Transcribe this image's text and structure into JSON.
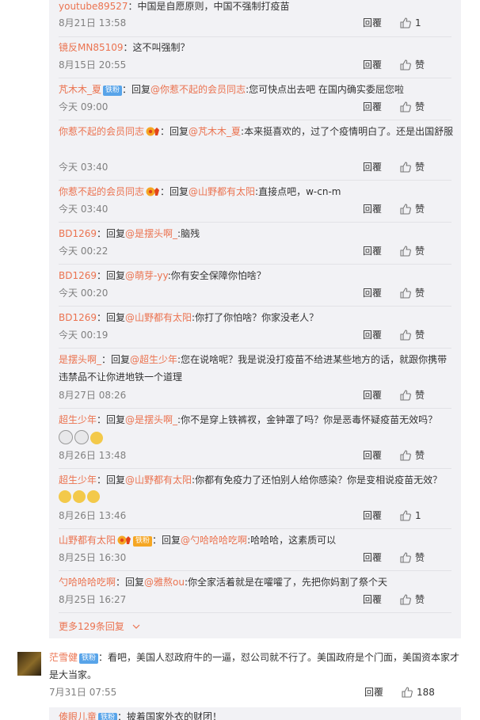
{
  "reply_thread": {
    "replies": [
      {
        "user": "youtube89527",
        "text": "：中国是自愿原则，中国不强制打疫苗",
        "time": "8月21日 13:58",
        "likes": "1"
      },
      {
        "user": "镜反MN85109",
        "text": "：这不叫强制？",
        "time": "8月15日 20:55",
        "likes": "赞"
      },
      {
        "user": "芃木木_夏",
        "badge": "铁粉",
        "reply_prefix": "：回复",
        "reply_to": "@你惹不起的会员同志",
        "text": ":您可快点出去吧 在国内确实委屈您啦",
        "time": "今天 09:00",
        "likes": "赞"
      },
      {
        "user": "你惹不起的会员同志",
        "reply_prefix": "：回复",
        "reply_to": "@芃木木_夏",
        "text": ":本来挺喜欢的，过了个疫情明白了。还是出国舒服",
        "time": "今天 03:40",
        "likes": "赞"
      },
      {
        "user": "你惹不起的会员同志",
        "reply_prefix": "：回复",
        "reply_to": "@山野都有太阳",
        "text": ":直接点吧，w-cn-m",
        "time": "今天 03:40",
        "likes": "赞"
      },
      {
        "user": "BD1269",
        "reply_prefix": "：回复",
        "reply_to": "@是摆头啊_",
        "text": ":脑残",
        "time": "今天 00:22",
        "likes": "赞"
      },
      {
        "user": "BD1269",
        "reply_prefix": "：回复",
        "reply_to": "@萌芽-yy",
        "text": ":你有安全保障你怕啥？",
        "time": "今天 00:20",
        "likes": "赞"
      },
      {
        "user": "BD1269",
        "reply_prefix": "：回复",
        "reply_to": "@山野都有太阳",
        "text": ":你打了你怕啥？你家没老人？",
        "time": "今天 00:19",
        "likes": "赞"
      },
      {
        "user": "是摆头啊_",
        "reply_prefix": "：回复",
        "reply_to": "@超生少年",
        "text": ":您在说啥呢？我是说没打疫苗不给进某些地方的话，就跟你携带违禁品不让你进地铁一个道理",
        "time": "8月27日 08:26",
        "likes": "赞"
      },
      {
        "user": "超生少年",
        "reply_prefix": "：回复",
        "reply_to": "@是摆头啊_",
        "text": ":你不是穿上铁裤衩，金钟罩了吗？你是恶毒怀疑疫苗无效吗？",
        "time": "8月26日 13:48",
        "likes": "赞"
      },
      {
        "user": "超生少年",
        "reply_prefix": "：回复",
        "reply_to": "@山野都有太阳",
        "text": ":你都有免疫力了还怕别人给你感染？你是变相说疫苗无效？",
        "time": "8月26日 13:46",
        "likes": "1"
      },
      {
        "user": "山野都有太阳",
        "badge": "铁粉",
        "reply_prefix": "：回复",
        "reply_to": "@勺哈哈哈吃啊",
        "text": ":哈哈哈，这素质可以",
        "time": "8月25日 16:30",
        "likes": "赞"
      },
      {
        "user": "勺哈哈哈吃啊",
        "reply_prefix": "：回复",
        "reply_to": "@雅熬ou",
        "text": ":你全家活着就是在嚯嚯了，先把你妈割了祭个天",
        "time": "8月25日 16:27",
        "likes": "赞"
      }
    ],
    "more_label": "更多129条回复",
    "reply_label": "回覆"
  },
  "main_comment": {
    "user": "茫雪健",
    "badge": "铁粉",
    "text": "：看吧，美国人怼政府牛的一逼，怼公司就不行了。美国政府是个门面，美国资本家才是大当家。",
    "time": "7月31日 07:55",
    "likes": "188",
    "reply_label": "回覆"
  },
  "next_comment": {
    "user": "傣眼儿童",
    "badge": "铁粉",
    "text": "：披着国家外衣的财团！"
  },
  "colors": {
    "accent": "#eb7350",
    "badge": "#58a4e9",
    "thread_bg": "#f2f2f5"
  }
}
